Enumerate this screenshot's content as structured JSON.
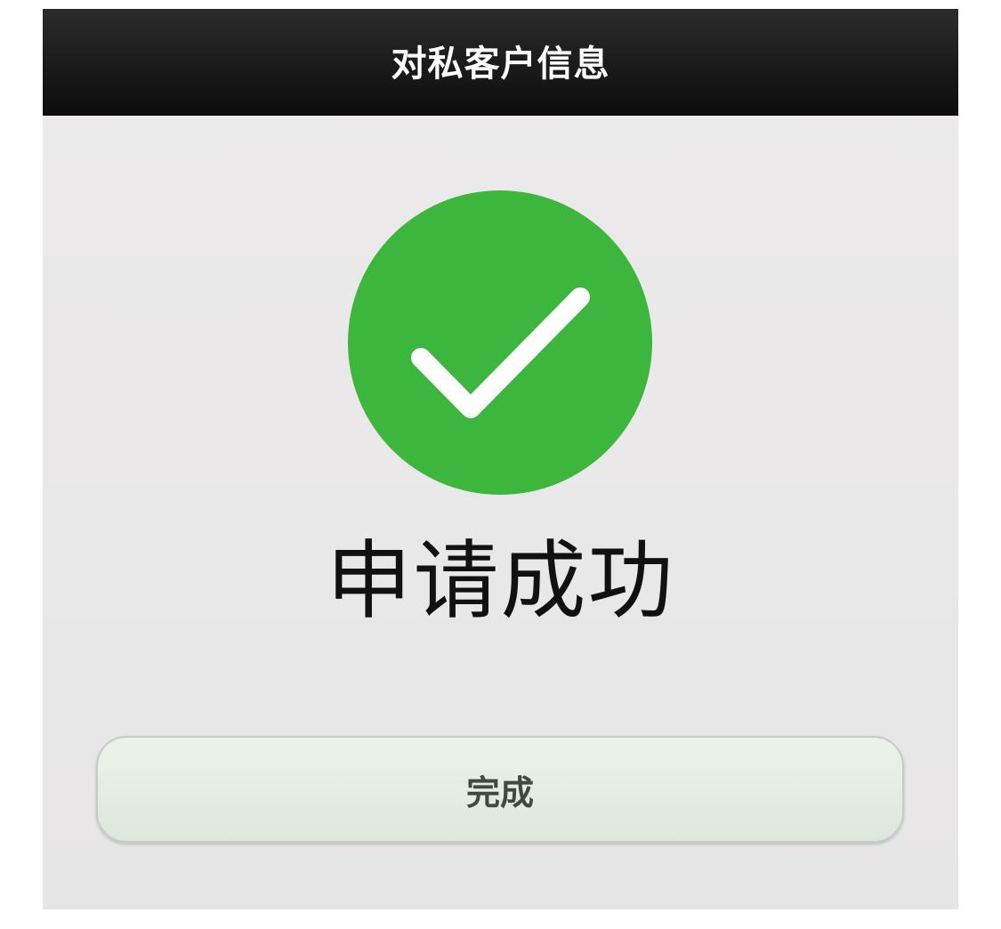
{
  "header": {
    "title": "对私客户信息"
  },
  "status": {
    "icon": "check-circle-icon",
    "icon_color": "#3cb63c",
    "message": "申请成功"
  },
  "actions": {
    "done_label": "完成"
  }
}
